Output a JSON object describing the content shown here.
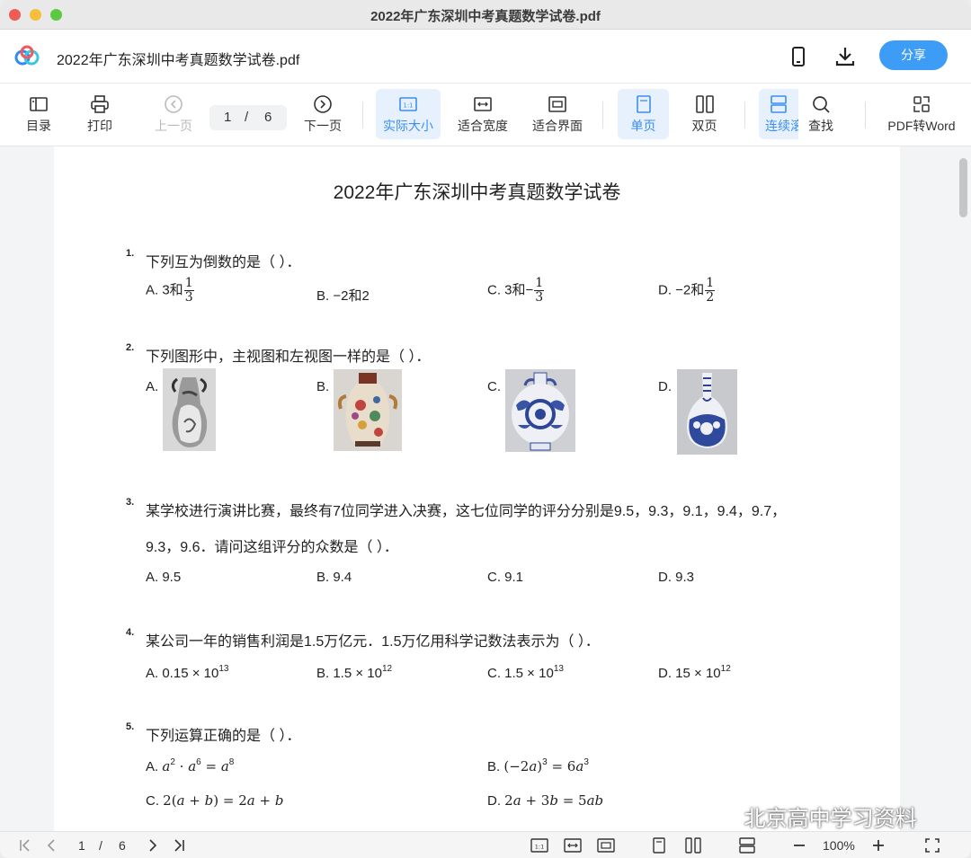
{
  "window": {
    "title": "2022年广东深圳中考真题数学试卷.pdf"
  },
  "appbar": {
    "file_name": "2022年广东深圳中考真题数学试卷.pdf",
    "share_label": "分享"
  },
  "toolbar": {
    "toc": "目录",
    "print": "打印",
    "prev": "上一页",
    "page_current": "1",
    "page_sep": "/",
    "page_total": "6",
    "next": "下一页",
    "actual_size": "实际大小",
    "fit_width": "适合宽度",
    "fit_screen": "适合界面",
    "single": "单页",
    "double": "双页",
    "continuous": "连续滚",
    "search": "查找",
    "pdf2word": "PDF转Word"
  },
  "document": {
    "title": "2022年广东深圳中考真题数学试卷",
    "questions": [
      {
        "num": "1.",
        "text": "下列互为倒数的是（  ）．"
      },
      {
        "num": "2.",
        "text": "下列图形中，主视图和左视图一样的是（  ）．",
        "options": [
          "A.",
          "B.",
          "C.",
          "D."
        ]
      },
      {
        "num": "3.",
        "text_line1": "某学校进行演讲比赛，最终有7位同学进入决赛，这七位同学的评分分别是9.5，9.3，9.1，9.4，9.7，",
        "text_line2": "9.3，9.6．请问这组评分的众数是（  ）．",
        "options": [
          "A. 9.5",
          "B. 9.4",
          "C. 9.1",
          "D. 9.3"
        ]
      },
      {
        "num": "4.",
        "text": "某公司一年的销售利润是1.5万亿元．1.5万亿用科学记数法表示为（  ）．"
      },
      {
        "num": "5.",
        "text": "下列运算正确的是（  ）．"
      }
    ],
    "q1_options": {
      "a_prefix": "A. 3和",
      "a_num": "1",
      "a_den": "3",
      "b": "B. −2和2",
      "c_prefix": "C. 3和−",
      "c_num": "1",
      "c_den": "3",
      "d_prefix": "D. −2和",
      "d_num": "1",
      "d_den": "2"
    },
    "q4_options": {
      "a": "A. 0.15 × 10",
      "a_exp": "13",
      "b": "B. 1.5 × 10",
      "b_exp": "12",
      "c": "C. 1.5 × 10",
      "c_exp": "13",
      "d": "D. 15 × 10",
      "d_exp": "12"
    },
    "q5_options": {
      "a_label": "A.",
      "b_label": "B.",
      "c_label": "C.",
      "d_label": "D."
    }
  },
  "statusbar": {
    "page_current": "1",
    "page_sep": "/",
    "page_total": "6",
    "zoom": "100%"
  },
  "watermark": "北京高中学习资料",
  "colors": {
    "accent": "#3d9cf5",
    "active_bg": "#e7f1fd"
  },
  "icons": [
    "app-logo-icon",
    "phone-icon",
    "download-icon",
    "toc-icon",
    "print-icon",
    "prev-page-icon",
    "next-page-icon",
    "actual-size-icon",
    "fit-width-icon",
    "fit-screen-icon",
    "single-page-icon",
    "double-page-icon",
    "continuous-icon",
    "search-icon",
    "pdf-to-word-icon",
    "first-page-icon",
    "prev-icon",
    "next-icon",
    "last-page-icon",
    "zoom-out-icon",
    "zoom-in-icon",
    "fullscreen-icon",
    "wechat-icon"
  ]
}
